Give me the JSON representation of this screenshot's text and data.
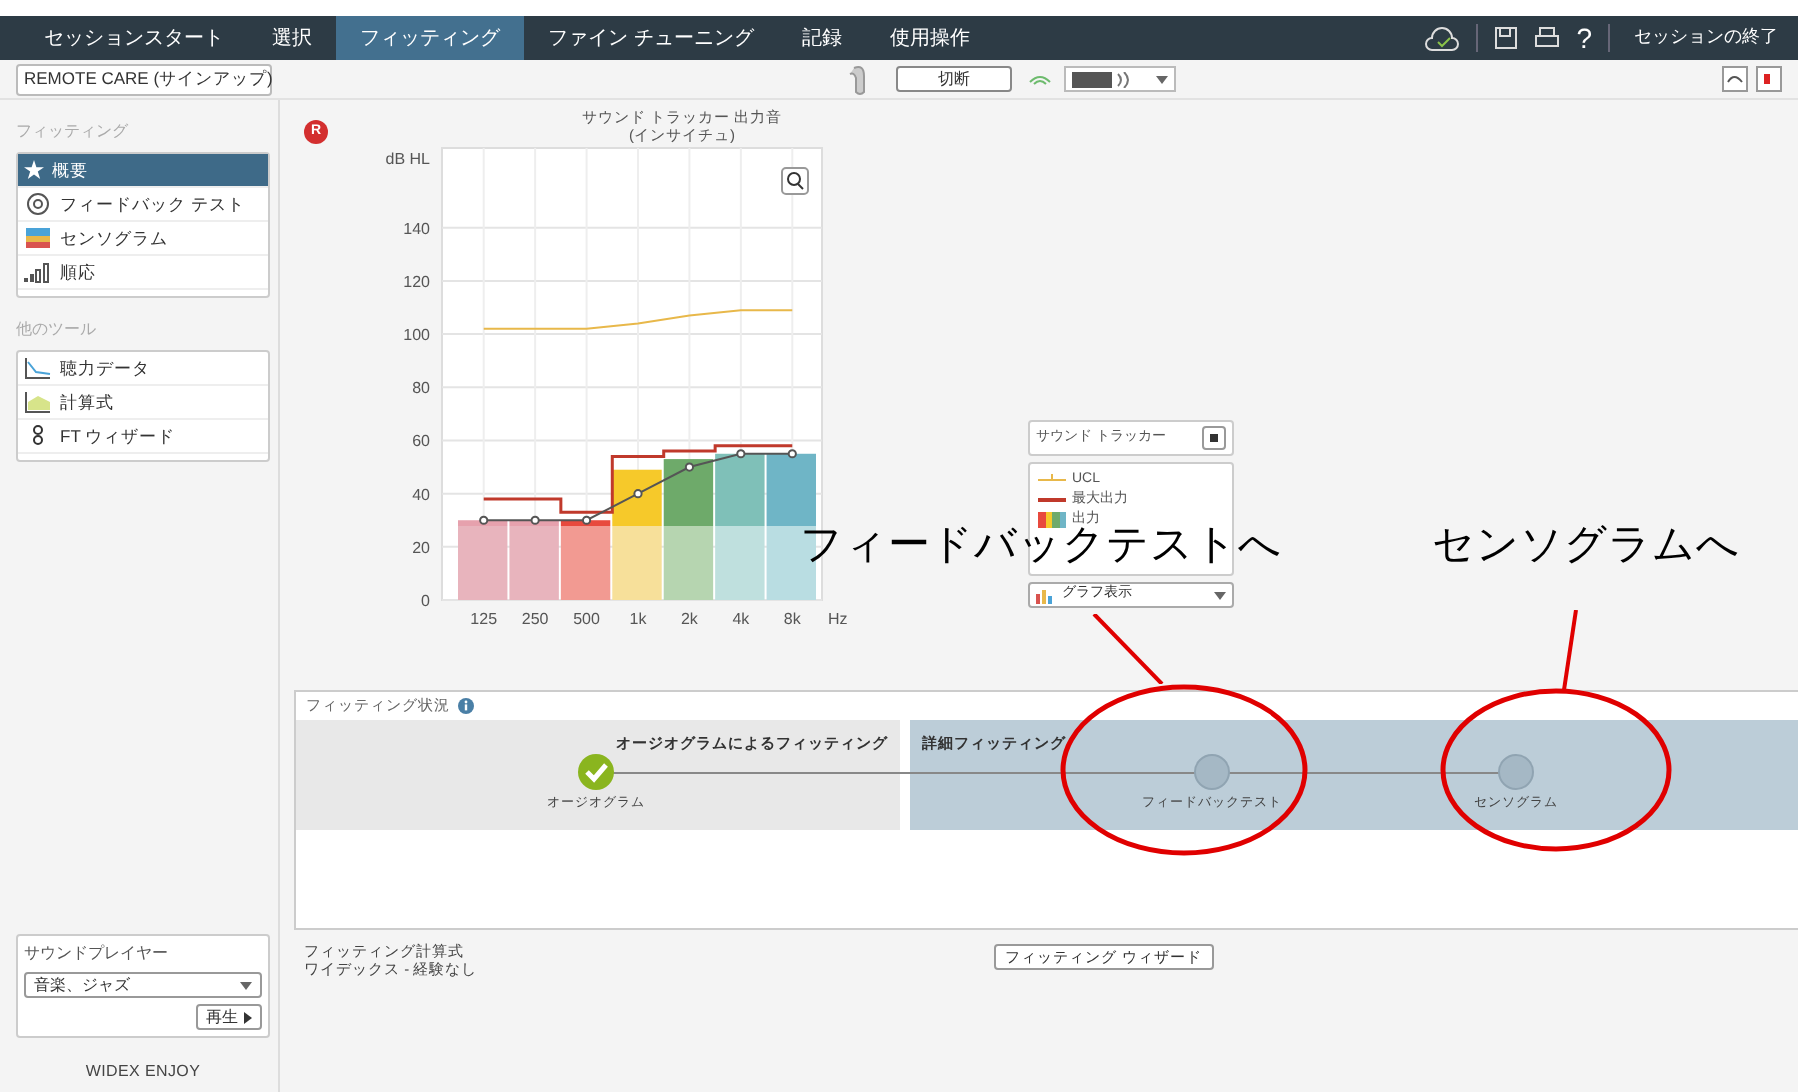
{
  "nav": {
    "tabs": [
      {
        "label": "セッションスタート",
        "selected": false
      },
      {
        "label": "選択",
        "selected": false
      },
      {
        "label": "フィッティング",
        "selected": true
      },
      {
        "label": "ファイン チューニング",
        "selected": false
      },
      {
        "label": "記録",
        "selected": false
      },
      {
        "label": "使用操作",
        "selected": false
      }
    ],
    "end_session": "セッションの終了",
    "help": "?"
  },
  "toolbar": {
    "remote_care": "REMOTE CARE (サインアップ)",
    "disconnect": "切断"
  },
  "sidebar": {
    "sections": [
      {
        "title": "フィッティング",
        "items": [
          {
            "label": "概要",
            "selected": true
          },
          {
            "label": "フィードバック テスト",
            "selected": false
          },
          {
            "label": "センソグラム",
            "selected": false
          },
          {
            "label": "順応",
            "selected": false
          }
        ]
      },
      {
        "title": "他のツール",
        "items": [
          {
            "label": "聴力データ",
            "selected": false
          },
          {
            "label": "計算式",
            "selected": false
          },
          {
            "label": "FT ウィザード",
            "selected": false
          }
        ]
      }
    ],
    "sound_player": {
      "title": "サウンドプレイヤー",
      "value": "音楽、ジャズ",
      "play": "再生"
    },
    "logo": "WIDEX ENJOY"
  },
  "chart_panel": {
    "side": "R",
    "title": "サウンド トラッカー 出力音",
    "subtitle": "(インサイチュ)",
    "chart_data": {
      "type": "bar",
      "grid": true,
      "ylabel": "dB HL",
      "xlabel": "Hz",
      "categories": [
        "125",
        "250",
        "500",
        "1k",
        "2k",
        "4k",
        "8k"
      ],
      "ylim": [
        0,
        170
      ],
      "yticks": [
        0,
        20,
        40,
        60,
        80,
        100,
        120,
        140
      ],
      "series": [
        {
          "name": "UCL",
          "type": "line",
          "color": "#e8b84a",
          "values": [
            102,
            102,
            102,
            104,
            107,
            109,
            109
          ]
        },
        {
          "name": "最大出力",
          "type": "step",
          "color": "#c0392b",
          "values": [
            38,
            38,
            33,
            54,
            56,
            58,
            58
          ]
        },
        {
          "name": "出力",
          "type": "bar",
          "values": [
            30,
            30,
            30,
            49,
            53,
            55,
            55
          ]
        },
        {
          "type": "line",
          "marker": true,
          "color": "#555555",
          "values": [
            30,
            30,
            30,
            40,
            50,
            55,
            55
          ]
        }
      ]
    }
  },
  "legend": {
    "title": "サウンド トラッカー",
    "view": "グラフ表示"
  },
  "status": {
    "title": "フィッティング状況",
    "groups": [
      {
        "title": "オージオグラムによるフィッティング",
        "kind": "done"
      },
      {
        "title": "詳細フィッティング",
        "kind": "pending"
      }
    ],
    "steps": [
      {
        "label": "オージオグラム",
        "done": true
      },
      {
        "label": "フィードバックテスト",
        "done": false
      },
      {
        "label": "センソグラム",
        "done": false
      }
    ]
  },
  "formula": {
    "title": "フィッティング計算式",
    "value": "ワイデックス - 経験なし",
    "wizard": "フィッティング ウィザード"
  },
  "annotations": [
    {
      "text": "フィードバックテストへ"
    },
    {
      "text": "センソグラムへ"
    }
  ]
}
